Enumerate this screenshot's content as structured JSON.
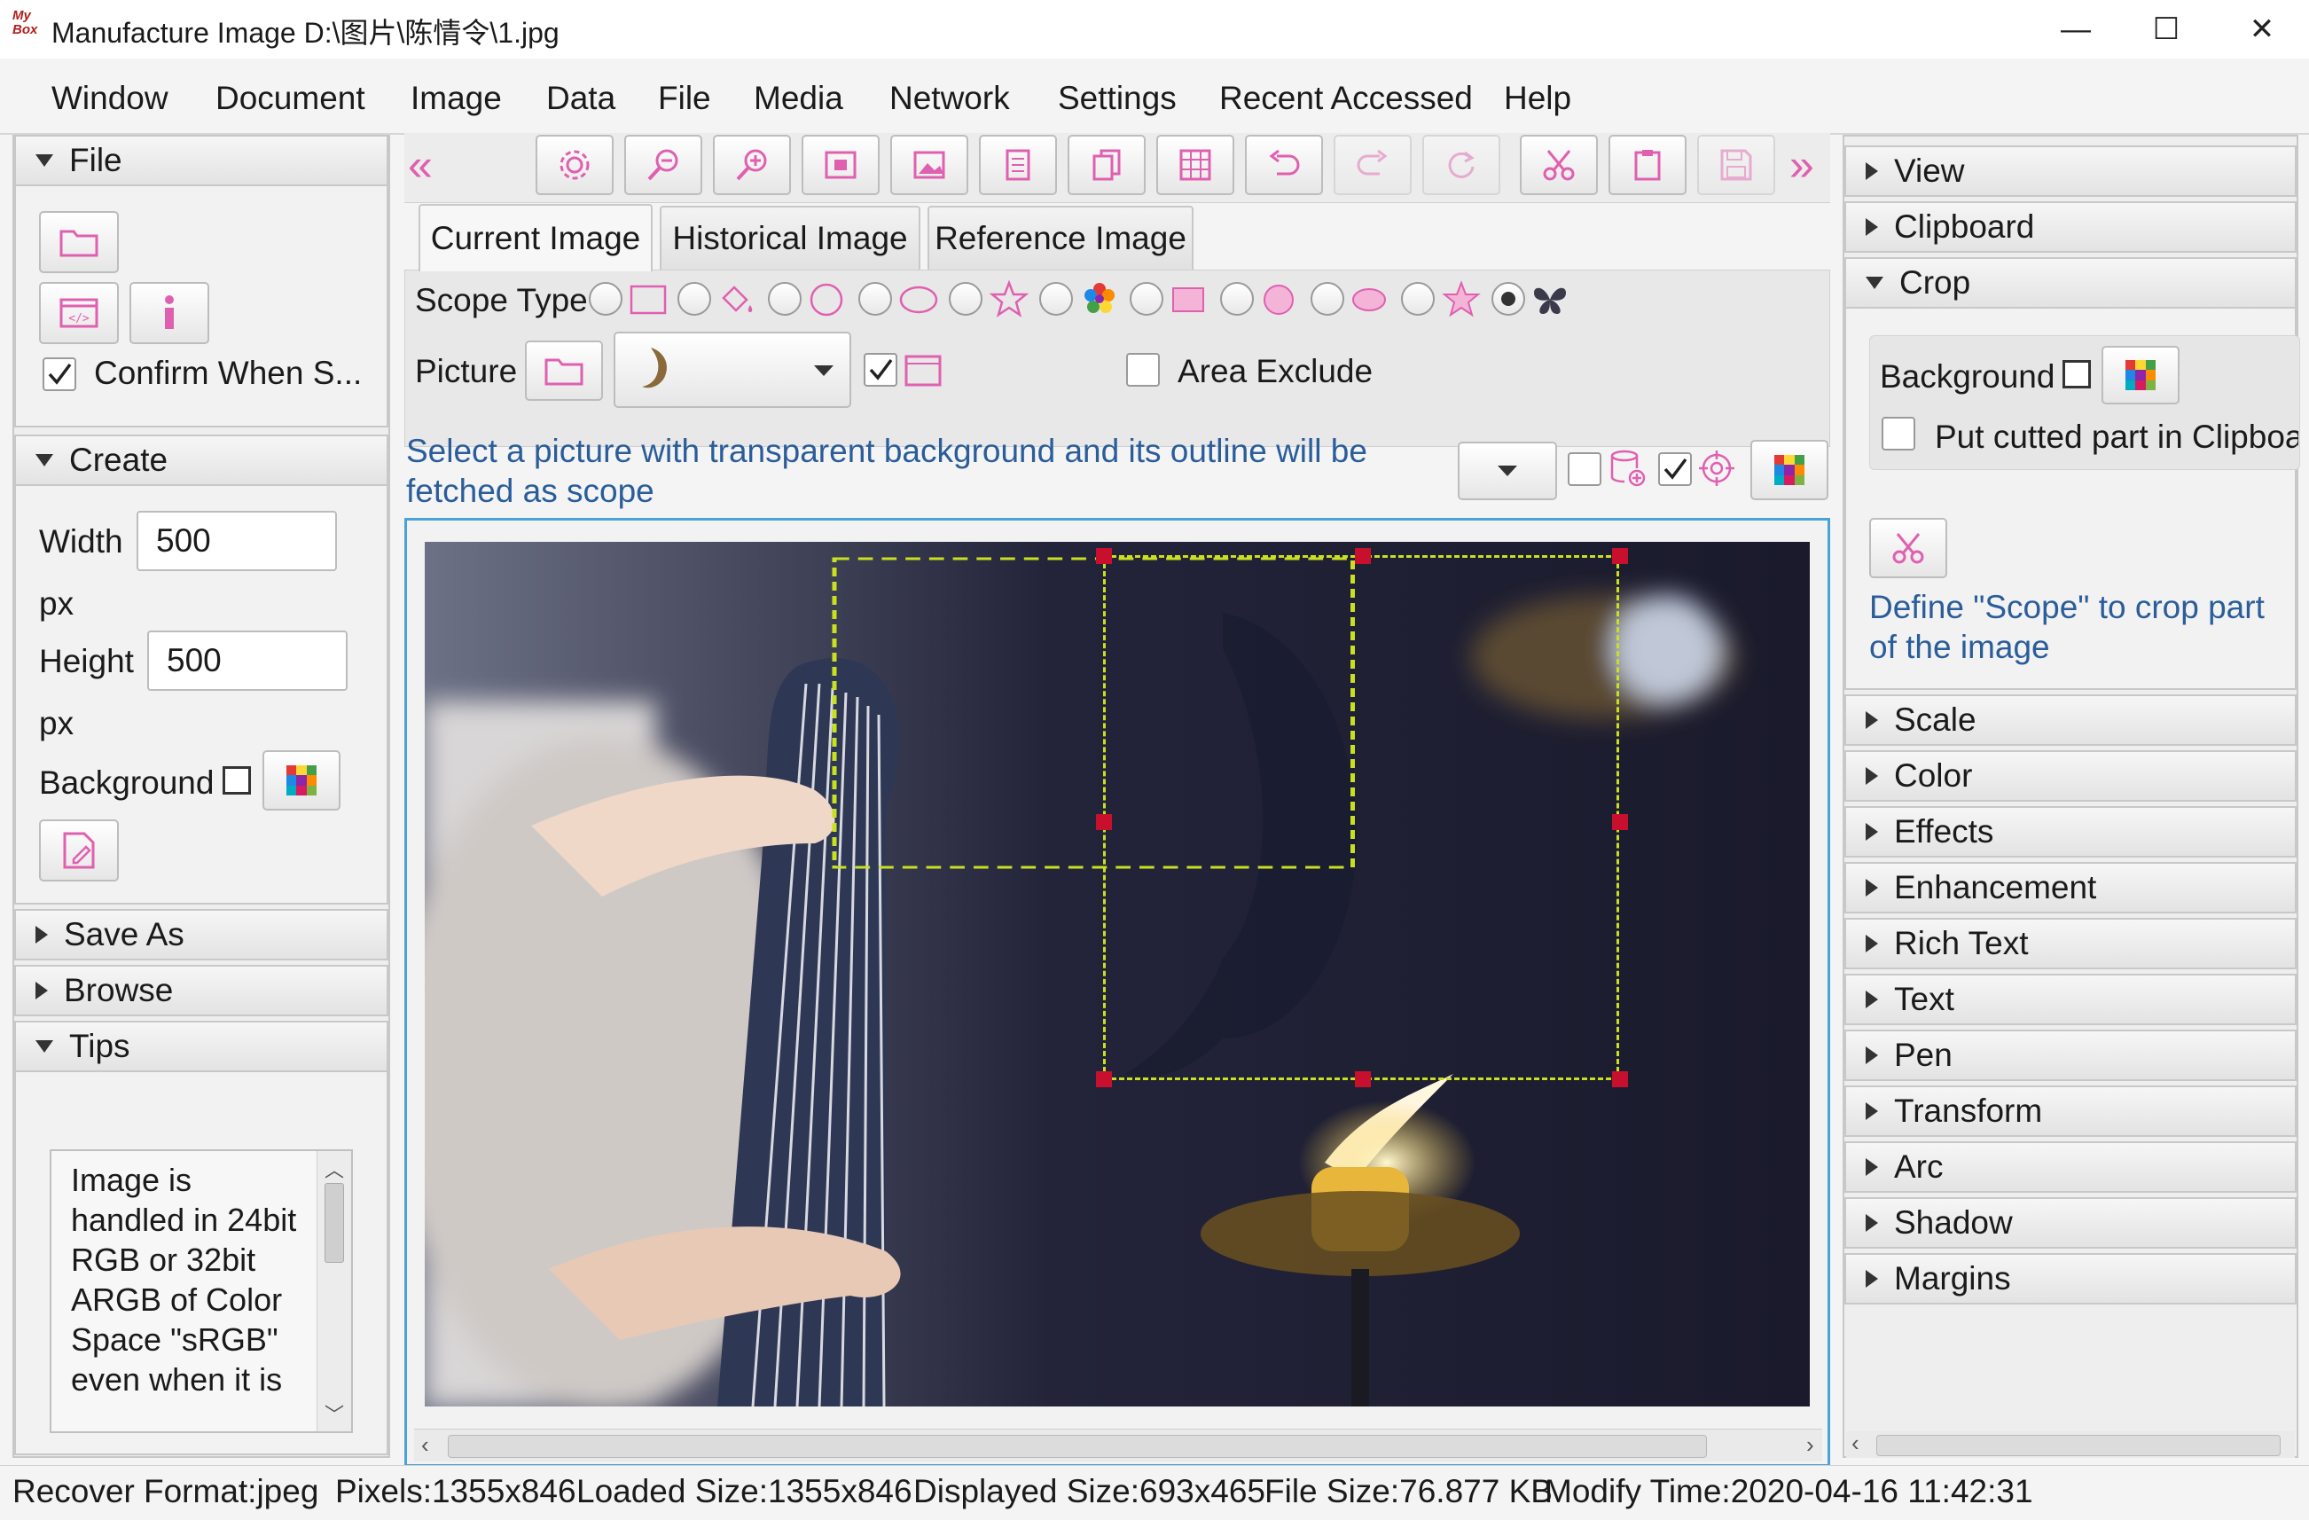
{
  "window": {
    "title": "Manufacture Image D:\\图片\\陈情令\\1.jpg",
    "logo_text": "My Box",
    "minimize": "—",
    "maximize": "☐",
    "close": "✕"
  },
  "menu": [
    "Window",
    "Document",
    "Image",
    "Data",
    "File",
    "Media",
    "Network",
    "Settings",
    "Recent Accessed",
    "Help"
  ],
  "left": {
    "file_header": "File",
    "confirm_label": "Confirm When S...",
    "confirm_checked": true,
    "create_header": "Create",
    "width_label": "Width",
    "width_value": "500",
    "width_unit": "px",
    "height_label": "Height",
    "height_value": "500",
    "height_unit": "px",
    "background_label": "Background",
    "save_as_header": "Save As",
    "browse_header": "Browse",
    "tips_header": "Tips",
    "tips_text": "Image is handled in 24bit RGB or 32bit ARGB of Color Space \"sRGB\" even when it is"
  },
  "tabs": [
    "Current Image",
    "Historical Image",
    "Reference Image"
  ],
  "scope": {
    "label": "Scope Type",
    "picture_label": "Picture",
    "area_exclude_label": "Area Exclude",
    "hint": "Select a picture with transparent background and its outline will be fetched as scope"
  },
  "right": {
    "view_header": "View",
    "clipboard_header": "Clipboard",
    "crop_header": "Crop",
    "crop_background_label": "Background",
    "put_cutted_label": "Put cutted part in Clipboa",
    "crop_hint": "Define \"Scope\" to crop part of the image",
    "sections": [
      "Scale",
      "Color",
      "Effects",
      "Enhancement",
      "Rich Text",
      "Text",
      "Pen",
      "Transform",
      "Arc",
      "Shadow",
      "Margins"
    ]
  },
  "status": {
    "recover": "Recover",
    "format": "Format:jpeg",
    "pixels": "Pixels:1355x846",
    "loaded": "Loaded Size:1355x846",
    "displayed": "Displayed Size:693x465",
    "filesize": "File Size:76.877 KB",
    "modify": "Modify Time:2020-04-16 11:42:31"
  },
  "colors": {
    "accent_pink": "#e060b0",
    "hint_blue": "#2a5d9a",
    "scope_dash": "#c8e020",
    "handle_red": "#c8102e",
    "image_border": "#4aa3d6"
  }
}
